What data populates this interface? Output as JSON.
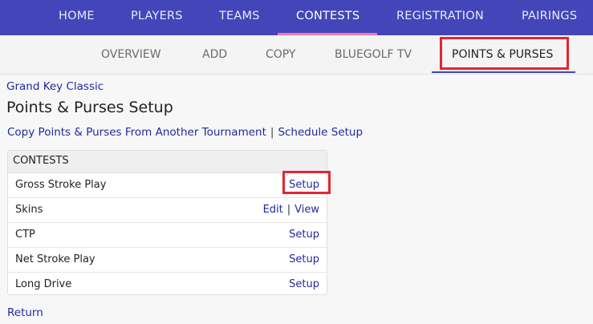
{
  "topnav": {
    "items": [
      {
        "label": "HOME"
      },
      {
        "label": "PLAYERS"
      },
      {
        "label": "TEAMS"
      },
      {
        "label": "CONTESTS"
      },
      {
        "label": "REGISTRATION"
      },
      {
        "label": "PAIRINGS"
      }
    ],
    "active": "CONTESTS"
  },
  "subnav": {
    "items": [
      {
        "label": "OVERVIEW"
      },
      {
        "label": "ADD"
      },
      {
        "label": "COPY"
      },
      {
        "label": "BLUEGOLF TV"
      },
      {
        "label": "POINTS & PURSES"
      }
    ],
    "active": "POINTS & PURSES"
  },
  "breadcrumb": "Grand Key Classic",
  "page_title": "Points & Purses Setup",
  "links": {
    "copy": "Copy Points & Purses From Another Tournament",
    "separator": "|",
    "schedule": "Schedule Setup"
  },
  "contests": {
    "header": "CONTESTS",
    "rows": [
      {
        "name": "Gross Stroke Play",
        "action": "Setup"
      },
      {
        "name": "Skins",
        "action_edit": "Edit",
        "separator": "|",
        "action_view": "View"
      },
      {
        "name": "CTP",
        "action": "Setup"
      },
      {
        "name": "Net Stroke Play",
        "action": "Setup"
      },
      {
        "name": "Long Drive",
        "action": "Setup"
      }
    ]
  },
  "return_label": "Return",
  "colors": {
    "nav_bg": "#4345b8",
    "active_underline": "#f07aa8",
    "highlight": "#e3262f",
    "link": "#1f2aa0"
  }
}
